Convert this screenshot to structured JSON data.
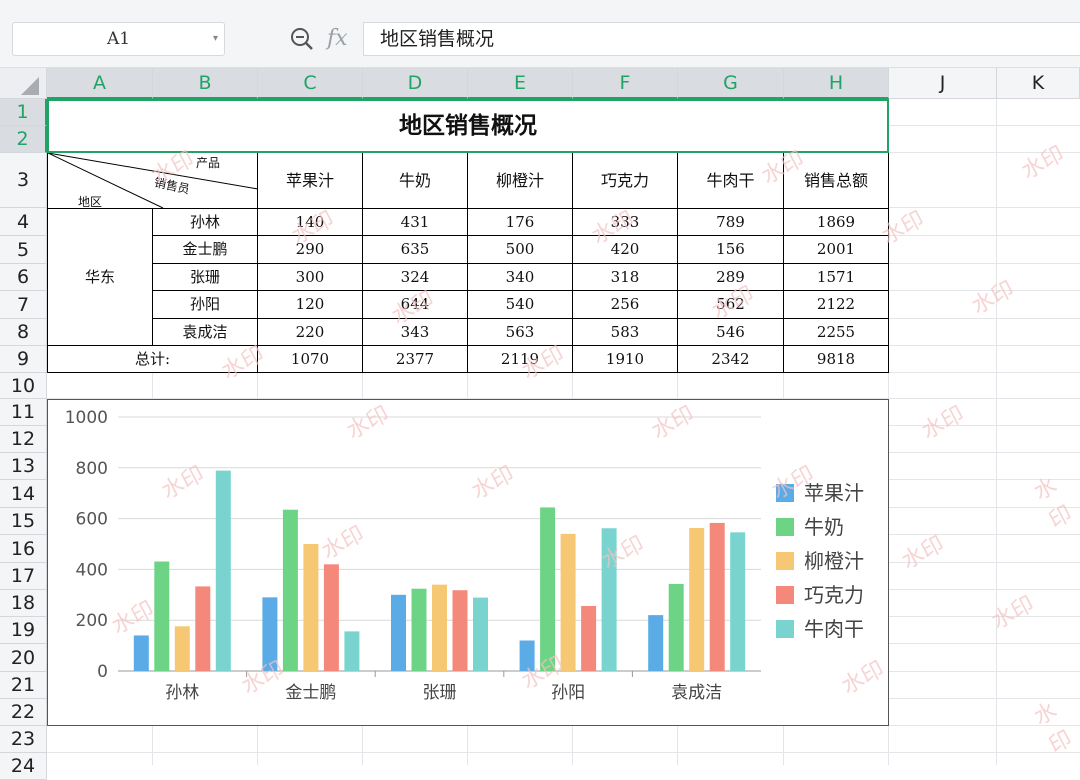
{
  "toolbar": {
    "cell_ref": "A1",
    "fx_label": "fx",
    "formula": "地区销售概况"
  },
  "columns": [
    "A",
    "B",
    "C",
    "D",
    "E",
    "F",
    "G",
    "H",
    "J",
    "K"
  ],
  "rows": [
    "1",
    "2",
    "3",
    "4",
    "5",
    "6",
    "7",
    "8",
    "9",
    "10",
    "11",
    "12",
    "13",
    "14",
    "15",
    "16",
    "17",
    "18",
    "19",
    "20",
    "21",
    "22",
    "23",
    "24"
  ],
  "sheet": {
    "title": "地区销售概况",
    "diag_product": "产品",
    "diag_seller": "销售员",
    "diag_region": "地区",
    "product_headers": [
      "苹果汁",
      "牛奶",
      "柳橙汁",
      "巧克力",
      "牛肉干",
      "销售总额"
    ],
    "region": "华东",
    "people": [
      "孙林",
      "金士鹏",
      "张珊",
      "孙阳",
      "袁成洁"
    ],
    "values": [
      [
        140,
        431,
        176,
        333,
        789,
        1869
      ],
      [
        290,
        635,
        500,
        420,
        156,
        2001
      ],
      [
        300,
        324,
        340,
        318,
        289,
        1571
      ],
      [
        120,
        644,
        540,
        256,
        562,
        2122
      ],
      [
        220,
        343,
        563,
        583,
        546,
        2255
      ]
    ],
    "total_label": "总计:",
    "totals": [
      1070,
      2377,
      2119,
      1910,
      2342,
      9818
    ]
  },
  "watermark_text": "水印",
  "chart_data": {
    "type": "bar",
    "categories": [
      "孙林",
      "金士鹏",
      "张珊",
      "孙阳",
      "袁成洁"
    ],
    "series": [
      {
        "name": "苹果汁",
        "values": [
          140,
          290,
          300,
          120,
          220
        ],
        "color": "#5aabe6"
      },
      {
        "name": "牛奶",
        "values": [
          431,
          635,
          324,
          644,
          343
        ],
        "color": "#6dd486"
      },
      {
        "name": "柳橙汁",
        "values": [
          176,
          500,
          340,
          540,
          563
        ],
        "color": "#f7c873"
      },
      {
        "name": "巧克力",
        "values": [
          333,
          420,
          318,
          256,
          583
        ],
        "color": "#f4897b"
      },
      {
        "name": "牛肉干",
        "values": [
          789,
          156,
          289,
          562,
          546
        ],
        "color": "#79d4cf"
      }
    ],
    "yticks": [
      0,
      200,
      400,
      600,
      800,
      1000
    ],
    "ylim": [
      0,
      1000
    ],
    "grid": true,
    "legend": "right"
  }
}
